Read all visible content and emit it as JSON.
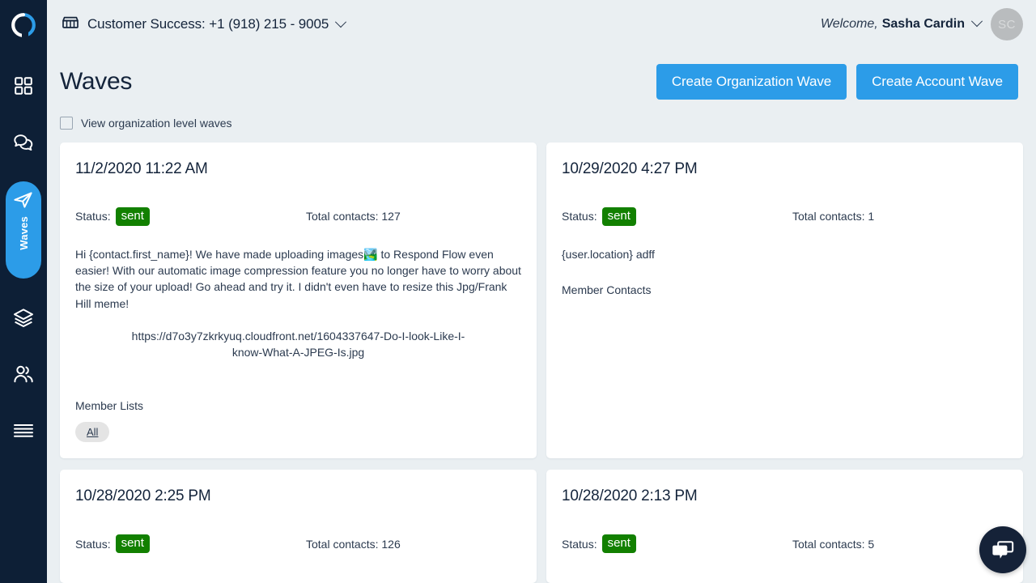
{
  "brand": {
    "accent": "#2c9ce8",
    "sidebar_bg": "#0d1f36",
    "page_bg": "#eaeff2",
    "status_green": "#128000",
    "logo_name": "respond-flow-logo"
  },
  "sidebar": {
    "items": [
      {
        "icon": "grid-dashboard-icon",
        "label": "Dashboard",
        "active": false
      },
      {
        "icon": "chat-bubbles-icon",
        "label": "Conversations",
        "active": false
      },
      {
        "icon": "paper-plane-icon",
        "label": "Waves",
        "active": true
      },
      {
        "icon": "layers-stack-icon",
        "label": "Lists",
        "active": false
      },
      {
        "icon": "people-group-icon",
        "label": "Contacts",
        "active": false
      },
      {
        "icon": "hamburger-menu-icon",
        "label": "Menu",
        "active": false
      }
    ],
    "active_label": "Waves"
  },
  "topbar": {
    "store_icon": "storefront-icon",
    "account": "Customer Success: +1 (918) 215 - 9005",
    "account_chevron": "chevron-down-icon",
    "welcome_word": "Welcome,",
    "user_name": "Sasha Cardin",
    "user_chevron": "chevron-down-icon",
    "avatar_initials": "SC"
  },
  "page": {
    "title": "Waves",
    "buttons": [
      {
        "label": "Create Organization Wave",
        "name": "create-organization-wave-button"
      },
      {
        "label": "Create Account Wave",
        "name": "create-account-wave-button"
      }
    ],
    "org_checkbox": {
      "checked": false,
      "label": "View organization level waves"
    }
  },
  "labels": {
    "status": "Status:",
    "total_contacts_prefix": "Total contacts:",
    "member_lists": "Member Lists",
    "member_contacts": "Member Contacts"
  },
  "cards": [
    {
      "date": "11/2/2020 11:22 AM",
      "status": "sent",
      "total_contacts": "Total contacts: 127",
      "message": "Hi {contact.first_name}! We have made uploading images🏞️ to Respond Flow even easier! With our automatic image compression feature you no longer have to worry about the size of your upload! Go ahead and try it. I didn't even have to resize this Jpg/Frank Hill meme!",
      "url": "https://d7o3y7zkrkyuq.cloudfront.net/1604337647-Do-I-look-Like-I-know-What-A-JPEG-Is.jpg",
      "section_title": "Member Lists",
      "chips": [
        "All"
      ]
    },
    {
      "date": "10/29/2020 4:27 PM",
      "status": "sent",
      "total_contacts": "Total contacts: 1",
      "message": "{user.location} adff",
      "section_title": "Member Contacts",
      "chips": []
    },
    {
      "date": "10/28/2020 2:25 PM",
      "status": "sent",
      "total_contacts": "Total contacts: 126"
    },
    {
      "date": "10/28/2020 2:13 PM",
      "status": "sent",
      "total_contacts": "Total contacts: 5"
    }
  ],
  "chat_widget": {
    "icon": "chat-bubbles-icon",
    "name": "chat-support-button"
  }
}
